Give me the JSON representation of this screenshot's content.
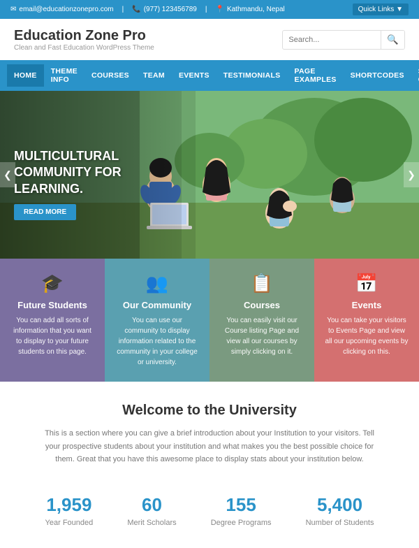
{
  "topbar": {
    "email": "email@educationzonepro.com",
    "phone": "(977) 123456789",
    "location": "Kathmandu, Nepal",
    "quick_links": "Quick Links ▼"
  },
  "header": {
    "site_title": "Education Zone Pro",
    "site_tagline": "Clean and Fast Education WordPress Theme",
    "search_placeholder": "Search..."
  },
  "nav": {
    "items": [
      {
        "label": "HOME",
        "active": true
      },
      {
        "label": "THEME INFO"
      },
      {
        "label": "COURSES"
      },
      {
        "label": "TEAM"
      },
      {
        "label": "EVENTS"
      },
      {
        "label": "TESTIMONIALS"
      },
      {
        "label": "PAGE EXAMPLES"
      },
      {
        "label": "SHORTCODES"
      },
      {
        "label": "STYLE GUIDE"
      }
    ]
  },
  "hero": {
    "title": "MULTICULTURAL COMMUNITY FOR LEARNING.",
    "read_more": "READ MORE",
    "prev": "❮",
    "next": "❯"
  },
  "features": [
    {
      "icon": "🎓",
      "title": "Future Students",
      "description": "You can add all sorts of information that you want to display to your future students on this page."
    },
    {
      "icon": "👥",
      "title": "Our Community",
      "description": "You can use our community to display information related to the community in your college or university."
    },
    {
      "icon": "📋",
      "title": "Courses",
      "description": "You can easily visit our Course listing Page and view all our courses by simply clicking on it."
    },
    {
      "icon": "📅",
      "title": "Events",
      "description": "You can take your visitors to Events Page and view all our upcoming events by clicking on this."
    }
  ],
  "welcome": {
    "title": "Welcome to the University",
    "description": "This is a section where you can give a brief introduction about your Institution to your visitors. Tell your prospective students about your institution and what makes you the best possible choice for them. Great that you have this awesome place to display stats about your institution below."
  },
  "stats": [
    {
      "number": "1,959",
      "label": "Year Founded"
    },
    {
      "number": "60",
      "label": "Merit Scholars"
    },
    {
      "number": "155",
      "label": "Degree Programs"
    },
    {
      "number": "5,400",
      "label": "Number of Students"
    }
  ]
}
